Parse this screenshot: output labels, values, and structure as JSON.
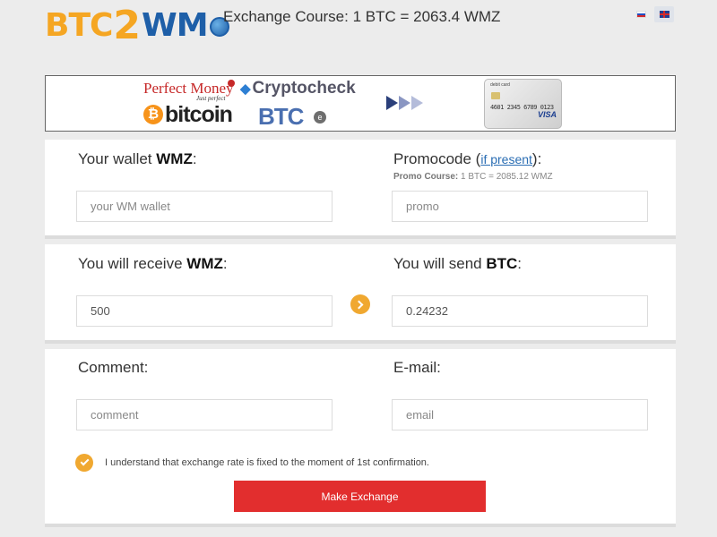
{
  "header": {
    "logo": {
      "part1": "BTC",
      "part2": "2",
      "part3": "WM"
    },
    "exchange_course": "Exchange Course: 1 BTC = 2063.4 WMZ",
    "languages": [
      {
        "code": "ru",
        "active": false
      },
      {
        "code": "en",
        "active": true
      }
    ]
  },
  "banner": {
    "perfect_money": "Perfect Money",
    "perfect_money_sub": "Just perfect",
    "cryptocheck": "Cryptocheck",
    "bitcoin": "bitcoin",
    "bitcoin_symbol": "₿",
    "btce": "BTC",
    "btce_symbol": "e",
    "card": {
      "type": "debit card",
      "number": "4601 2345 6789 0123",
      "brand": "VISA"
    }
  },
  "wallet": {
    "label_prefix": "Your wallet ",
    "label_currency": "WMZ",
    "label_suffix": ":",
    "placeholder": "your WM wallet"
  },
  "promo": {
    "label_prefix": "Promocode (",
    "link_text": "if present",
    "label_suffix": "):",
    "note_label": "Promo Course:",
    "note_value": " 1 BTC = 2085.12 WMZ",
    "placeholder": "promo"
  },
  "receive": {
    "label_prefix": "You will receive ",
    "label_currency": "WMZ",
    "label_suffix": ":",
    "value": "500"
  },
  "send": {
    "label_prefix": "You will send ",
    "label_currency": "BTC",
    "label_suffix": ":",
    "value": "0.24232"
  },
  "comment": {
    "label": "Comment:",
    "placeholder": "comment"
  },
  "email": {
    "label": "E-mail:",
    "placeholder": "email"
  },
  "agreement": {
    "checked": true,
    "text": "I understand that exchange rate is fixed to the moment of 1st confirmation."
  },
  "submit": {
    "label": "Make Exchange"
  },
  "colors": {
    "accent": "#f0a830",
    "button": "#e22e2e",
    "link": "#2a6db3",
    "logo_orange": "#f5a623",
    "logo_blue": "#1e5fa8"
  }
}
